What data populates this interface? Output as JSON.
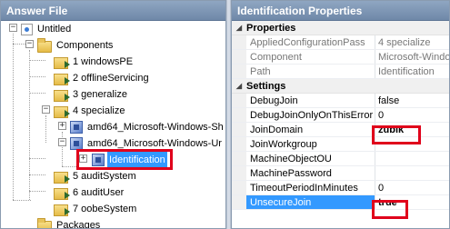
{
  "left_pane": {
    "title": "Answer File",
    "tree": {
      "root": "Untitled",
      "components": "Components",
      "passes": [
        "1 windowsPE",
        "2 offlineServicing",
        "3 generalize",
        "4 specialize",
        "5 auditSystem",
        "6 auditUser",
        "7 oobeSystem"
      ],
      "specialize_children": [
        "amd64_Microsoft-Windows-Sh",
        "amd64_Microsoft-Windows-Ur"
      ],
      "selected_node": "Identification",
      "packages": "Packages"
    }
  },
  "right_pane": {
    "title": "Identification Properties",
    "categories": [
      {
        "name": "Properties",
        "rows": [
          {
            "name": "AppliedConfigurationPass",
            "value": "4 specialize"
          },
          {
            "name": "Component",
            "value": "Microsoft-Window"
          },
          {
            "name": "Path",
            "value": "Identification"
          }
        ]
      },
      {
        "name": "Settings",
        "rows": [
          {
            "name": "DebugJoin",
            "value": "false"
          },
          {
            "name": "DebugJoinOnlyOnThisError",
            "value": "0"
          },
          {
            "name": "JoinDomain",
            "value": "zubik"
          },
          {
            "name": "JoinWorkgroup",
            "value": ""
          },
          {
            "name": "MachineObjectOU",
            "value": ""
          },
          {
            "name": "MachinePassword",
            "value": ""
          },
          {
            "name": "TimeoutPeriodInMinutes",
            "value": "0"
          },
          {
            "name": "UnsecureJoin",
            "value": "true"
          }
        ]
      }
    ]
  },
  "highlight_color": "#e0001b",
  "selection_color": "#3399ff"
}
